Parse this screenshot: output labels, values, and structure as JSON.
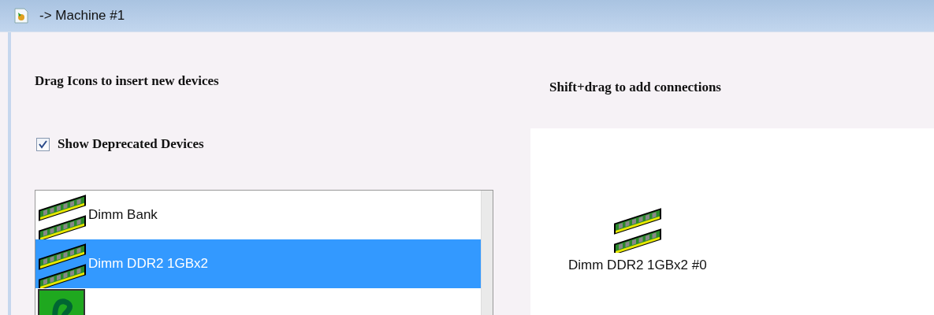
{
  "window": {
    "title": "-> Machine #1"
  },
  "palette": {
    "heading": "Drag Icons to insert new devices",
    "show_deprecated": {
      "label": "Show Deprecated Devices",
      "checked": true
    },
    "items": [
      {
        "label": "Dimm Bank",
        "kind": "dimm",
        "selected": false
      },
      {
        "label": "Dimm DDR2 1GBx2",
        "kind": "dimm",
        "selected": true
      },
      {
        "kind": "graphics",
        "selected": false
      }
    ]
  },
  "canvas": {
    "heading": "Shift+drag to add connections",
    "nodes": [
      {
        "label": "Dimm DDR2 1GBx2 #0",
        "kind": "dimm"
      }
    ]
  }
}
